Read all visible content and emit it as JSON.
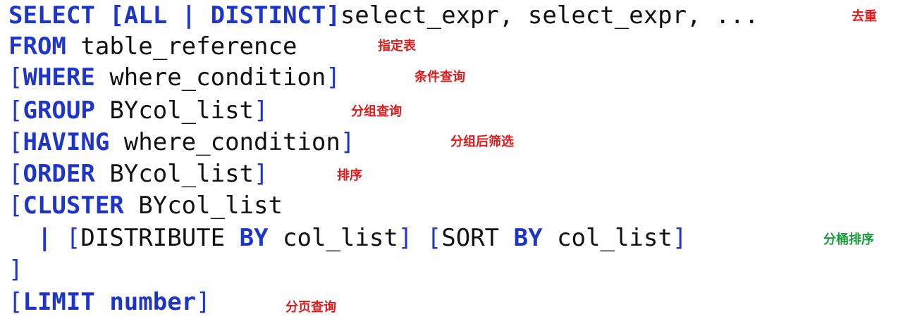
{
  "syntax": {
    "select_kw": "SELECT",
    "all_distinct": "[ALL | DISTINCT]",
    "select_rest": "select_expr, select_expr, ...",
    "from_kw": "FROM",
    "from_text": "table_reference",
    "where_open": "[",
    "where_kw": "WHERE",
    "where_text": "where_condition",
    "where_close": "]",
    "group_open": "[",
    "group_kw": "GROUP",
    "group_text": "BYcol_list",
    "group_close": "]",
    "having_open": "[",
    "having_kw": "HAVING",
    "having_text": "where_condition",
    "having_close": "]",
    "order_open": "[",
    "order_kw": "ORDER",
    "order_text": "BYcol_list",
    "order_close": "]",
    "cluster_open": "[",
    "cluster_kw": "CLUSTER",
    "cluster_text": "BYcol_list",
    "distribute_pipe": "|",
    "distribute_open": "[",
    "distribute_text": "DISTRIBUTE",
    "distribute_by": "BY",
    "distribute_rest": "col_list",
    "distribute_close": "]",
    "sort_open": "[",
    "sort_text": "SORT",
    "sort_by": "BY",
    "sort_rest": "col_list",
    "sort_close": "]",
    "cluster_close": "]",
    "limit_open": "[",
    "limit_kw": "LIMIT",
    "limit_text": "number",
    "limit_close": "]"
  },
  "annotations": {
    "dedup": "去重",
    "table": "指定表",
    "where": "条件查询",
    "group": "分组查询",
    "having": "分组后筛选",
    "order": "排序",
    "bucket_sort": "分桶排序",
    "limit": "分页查询"
  },
  "colors": {
    "keyword": "#1f35c8",
    "annotation_red": "#e11b1b",
    "annotation_green": "#1a9b3b"
  }
}
